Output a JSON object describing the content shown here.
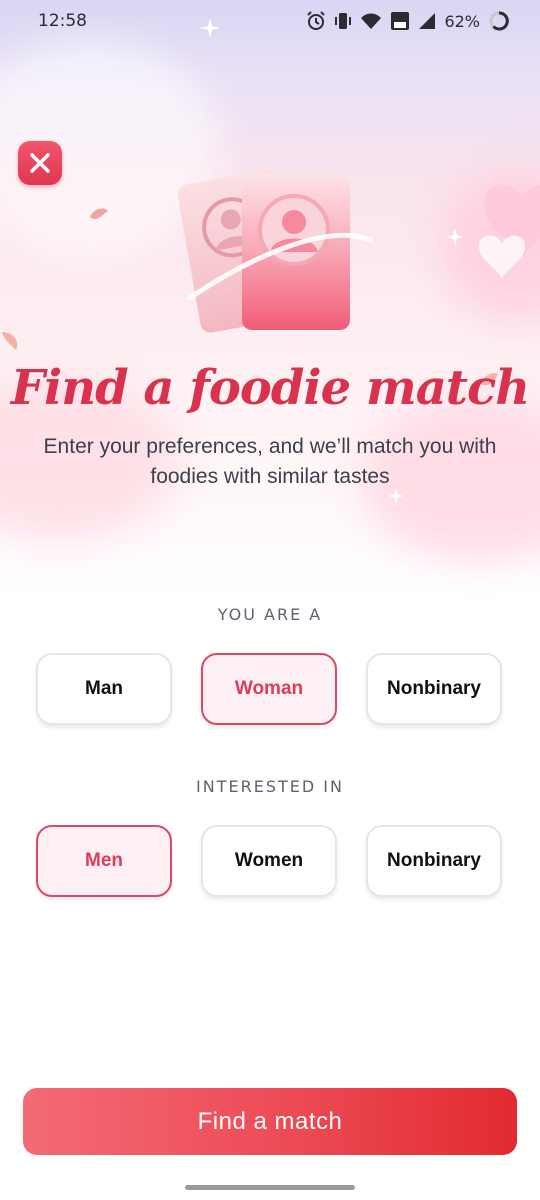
{
  "status_bar": {
    "time": "12:58",
    "battery": "62%"
  },
  "header": {
    "close_icon": "close-icon"
  },
  "hero": {
    "title": "Find a foodie match",
    "subtitle": "Enter your preferences, and we’ll match you with foodies with similar tastes",
    "illustration": "profile-cards-icon"
  },
  "you_are": {
    "label": "YOU ARE A",
    "options": [
      "Man",
      "Woman",
      "Nonbinary"
    ],
    "selected": "Woman"
  },
  "interested_in": {
    "label": "INTERESTED IN",
    "options": [
      "Men",
      "Women",
      "Nonbinary"
    ],
    "selected": "Men"
  },
  "cta": {
    "label": "Find a match"
  },
  "colors": {
    "accent": "#d8324f",
    "selected_bg": "#fdf0f4",
    "cta": "#ec4a55"
  }
}
